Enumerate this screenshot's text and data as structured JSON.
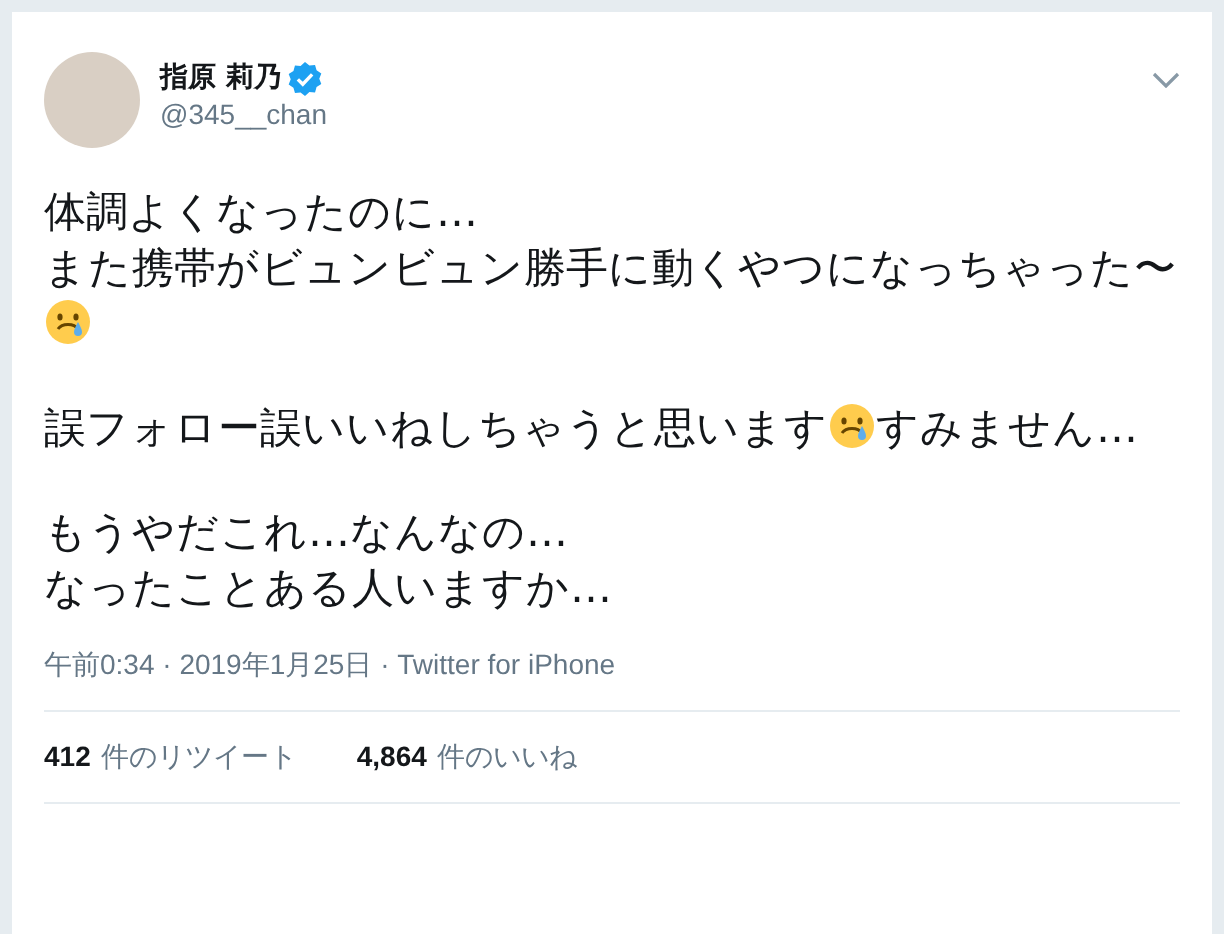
{
  "tweet": {
    "author": {
      "name": "指原 莉乃",
      "handle": "@345__chan",
      "verified": true
    },
    "paragraphs": [
      [
        {
          "kind": "text",
          "text": "体調よくなったのに…\nまた携帯がビュンビュン勝手に動くやつになっちゃった〜"
        },
        {
          "kind": "emoji"
        }
      ],
      [
        {
          "kind": "text",
          "text": "誤フォロー誤いいねしちゃうと思います"
        },
        {
          "kind": "emoji"
        },
        {
          "kind": "text",
          "text": "すみません…"
        }
      ],
      [
        {
          "kind": "text",
          "text": "もうやだこれ…なんなの…\nなったことある人いますか…"
        }
      ]
    ],
    "meta": "午前0:34 · 2019年1月25日 · Twitter for iPhone",
    "stats": [
      {
        "count": "412",
        "label": "件のリツイート"
      },
      {
        "count": "4,864",
        "label": "件のいいね"
      }
    ]
  }
}
